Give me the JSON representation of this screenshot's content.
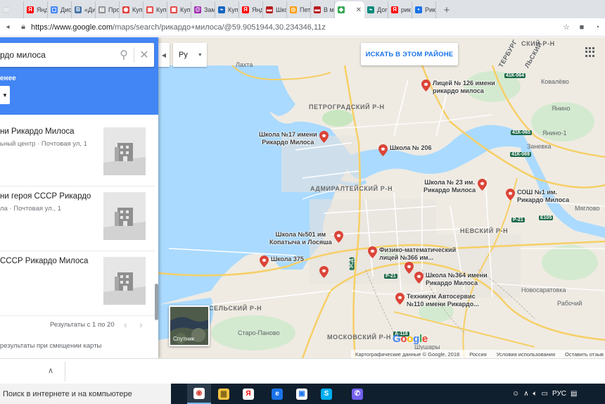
{
  "browser": {
    "tabs": [
      {
        "label": "",
        "icon": "generic",
        "color": "#dadce0"
      },
      {
        "label": "Янд",
        "icon": "yandex",
        "color": "#ff0000"
      },
      {
        "label": "Дис",
        "icon": "chat",
        "color": "#4285f4"
      },
      {
        "label": "«Ди",
        "icon": "vk",
        "color": "#4a76a8"
      },
      {
        "label": "Про",
        "icon": "page",
        "color": "#888888"
      },
      {
        "label": "Куп",
        "icon": "shop",
        "color": "#e53935"
      },
      {
        "label": "Куп",
        "icon": "avito",
        "color": "#e53935"
      },
      {
        "label": "Куп",
        "icon": "avito",
        "color": "#e53935"
      },
      {
        "label": "Зам",
        "icon": "spiral",
        "color": "#9c27b0"
      },
      {
        "label": "Куп",
        "icon": "ga",
        "color": "#1565c0"
      },
      {
        "label": "Янд",
        "icon": "yandex",
        "color": "#ff0000"
      },
      {
        "label": "Шко",
        "icon": "flag",
        "color": "#b71c1c"
      },
      {
        "label": "Пет",
        "icon": "circle",
        "color": "#ff9800"
      },
      {
        "label": "В ма",
        "icon": "flag",
        "color": "#b71c1c"
      },
      {
        "label": "",
        "icon": "maps",
        "color": "#34a853",
        "active": true
      },
      {
        "label": "Дог",
        "icon": "ga",
        "color": "#00897b"
      },
      {
        "label": "рик",
        "icon": "yandex",
        "color": "#ff0000"
      },
      {
        "label": "Рик",
        "icon": "dot",
        "color": "#1a73e8"
      }
    ],
    "url_host": "https://www.google.com",
    "url_path": "/maps/search/рикардо+милоса/@59.9051944,30.234346,11z"
  },
  "panel": {
    "search_query": "рдо милоса",
    "filter_label": "енее",
    "results": [
      {
        "title": "ни Рикардо Милоса",
        "subtitle": "ьный центр · Почтовая ул, 1"
      },
      {
        "title": "ни героя СССР Рикардо",
        "subtitle": "ла · Почтовая ул., 1"
      },
      {
        "title": "СССР Рикардо Милоса",
        "subtitle": ""
      }
    ],
    "pagination": "Результаты с 1 по 20",
    "update_text": "результаты при смещении карты"
  },
  "map": {
    "lang": "Ру",
    "search_area_button": "ИСКАТЬ В ЭТОМ РАЙОНЕ",
    "districts": [
      {
        "name": "ПЕТРОГРАДСКИЙ Р-Н"
      },
      {
        "name": "АДМИРАЛТЕЙСКИЙ Р-Н"
      },
      {
        "name": "НЕВСКИЙ Р-Н"
      },
      {
        "name": "МОСКОВСКИЙ Р-Н"
      },
      {
        "name": "СЕЛЬСКИЙ Р-Н"
      },
      {
        "name": "СКИЙ Р-Н"
      }
    ],
    "places": [
      "Лахта",
      "Ковалёво",
      "Янино",
      "Янино-1",
      "Заневка",
      "Мяглово",
      "Новосаратовка",
      "Рабочий",
      "Старо-Паново",
      "Шушары",
      "ТЕРБУРГ",
      "ЛЬСКИЙ"
    ],
    "road_shields": [
      "41К-064",
      "41К-065",
      "41К-069",
      "Р-21",
      "Е105",
      "Р-21",
      "А-118",
      "ЗСД"
    ],
    "markers": [
      {
        "label": "Лицей № 126 имени\nрикардо милоса"
      },
      {
        "label": "Школа №17 имени\nРикардо Милоса"
      },
      {
        "label": "Школа № 206"
      },
      {
        "label": "Школа № 23 им.\nРикардо Милоса"
      },
      {
        "label": "СОШ №1 им.\nРикардо Милоса"
      },
      {
        "label": "Школа №501 им\nКопатыча и Лосяша"
      },
      {
        "label": "Физико-математический\nлицей №366 им..."
      },
      {
        "label": "Школа 375"
      },
      {
        "label": ""
      },
      {
        "label": ""
      },
      {
        "label": "Школа №364 имени\nРикардо Милоса"
      },
      {
        "label": "Техникум Автосервис\n№110 имени Рикардо..."
      }
    ],
    "marker_color": "#db4437",
    "satellite_label": "Спутник",
    "google_logo": "Google",
    "attribution": [
      "Картографические данные © Google, 2018",
      "Россия",
      "Условия использования",
      "Оставить отзыв"
    ]
  },
  "taskbar": {
    "search_placeholder": "Поиск в интернете и на компьютере",
    "apps": [
      "chrome",
      "explorer",
      "yandex",
      "edge",
      "store",
      "skype",
      "viber"
    ],
    "lang": "РУС"
  }
}
